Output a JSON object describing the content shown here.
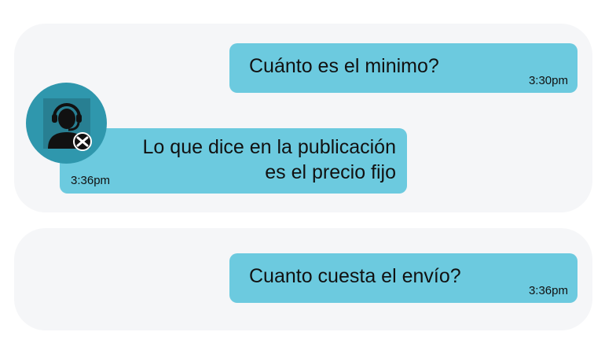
{
  "conversation": {
    "messages": [
      {
        "direction": "outgoing",
        "text": "Cuánto es el minimo?",
        "time": "3:30pm"
      },
      {
        "direction": "incoming",
        "text_line_1": "Lo que dice en la publicación",
        "text_line_2": "es el precio fijo",
        "time": "3:36pm"
      },
      {
        "direction": "outgoing",
        "text": "Cuanto cuesta el envío?",
        "time": "3:36pm"
      }
    ]
  },
  "avatar": {
    "icon": "support-agent-icon"
  },
  "colors": {
    "bubble": "#6ccadf",
    "panel": "#f5f6f8",
    "avatar_bg": "#2f97ad"
  }
}
